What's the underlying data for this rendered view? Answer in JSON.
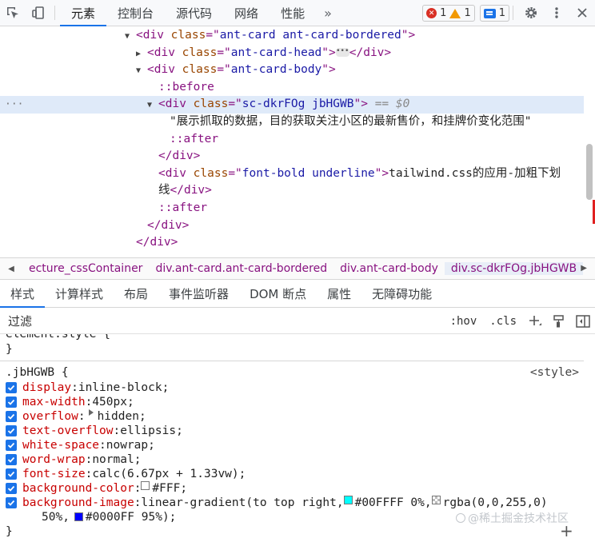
{
  "toolbar": {
    "tabs": [
      "元素",
      "控制台",
      "源代码",
      "网络",
      "性能"
    ],
    "more": "»",
    "errors": "1",
    "warnings": "1",
    "messages": "1"
  },
  "tree": {
    "line1": {
      "tag": "div",
      "attr": "class",
      "val": "ant-card ant-card-bordered"
    },
    "line2": {
      "tag": "div",
      "attr": "class",
      "val": "ant-card-head",
      "close": "</div>"
    },
    "line3": {
      "tag": "div",
      "attr": "class",
      "val": "ant-card-body"
    },
    "before": "::before",
    "selected": {
      "tag": "div",
      "attr": "class",
      "val": "sc-dkrFOg jbHGWB",
      "eq": "== $0"
    },
    "text1": "\"展示抓取的数据，目的获取关注小区的最新售价，和挂牌价变化范围\"",
    "after1": "::after",
    "close1": "</div>",
    "bold": {
      "tag": "div",
      "attr": "class",
      "val": "font-bold underline",
      "text": "tailwind.css的应用-加粗下划",
      "text2": "线"
    },
    "close_inner": "</div>",
    "after2": "::after",
    "close2": "</div>",
    "close3": "</div>"
  },
  "breadcrumbs": [
    "ecture_cssContainer",
    "div.ant-card.ant-card-bordered",
    "div.ant-card-body",
    "div.sc-dkrFOg.jbHGWB"
  ],
  "styles_tabs": [
    "样式",
    "计算样式",
    "布局",
    "事件监听器",
    "DOM 断点",
    "属性",
    "无障碍功能"
  ],
  "filter": {
    "placeholder": "过滤",
    "hov": ":hov",
    "cls": ".cls"
  },
  "rule": {
    "prev_close": "}",
    "selector": ".jbHGWB {",
    "origin": "<style>",
    "decls": [
      {
        "prop": "display",
        "value": "inline-block;"
      },
      {
        "prop": "max-width",
        "value": "450px;"
      },
      {
        "prop": "overflow",
        "value": "hidden;"
      },
      {
        "prop": "text-overflow",
        "value": "ellipsis;"
      },
      {
        "prop": "white-space",
        "value": "nowrap;"
      },
      {
        "prop": "word-wrap",
        "value": "normal;"
      },
      {
        "prop": "font-size",
        "value": "calc(6.67px + 1.33vw);"
      },
      {
        "prop": "background-color",
        "value": "#FFF;"
      },
      {
        "prop": "background-image",
        "value_a": "linear-gradient(to top right,",
        "value_b": "#00FFFF 0%,",
        "value_c": "rgba(0,0,255,0)",
        "value_d": "50%,",
        "value_e": "#0000FF 95%);"
      }
    ],
    "close": "}",
    "colors": {
      "white": "#FFFFFF",
      "cyan": "#00FFFF",
      "transparent_blue": "#d8d8d8",
      "blue": "#0000FF"
    }
  },
  "watermark": "@稀土掘金技术社区",
  "add": "+"
}
